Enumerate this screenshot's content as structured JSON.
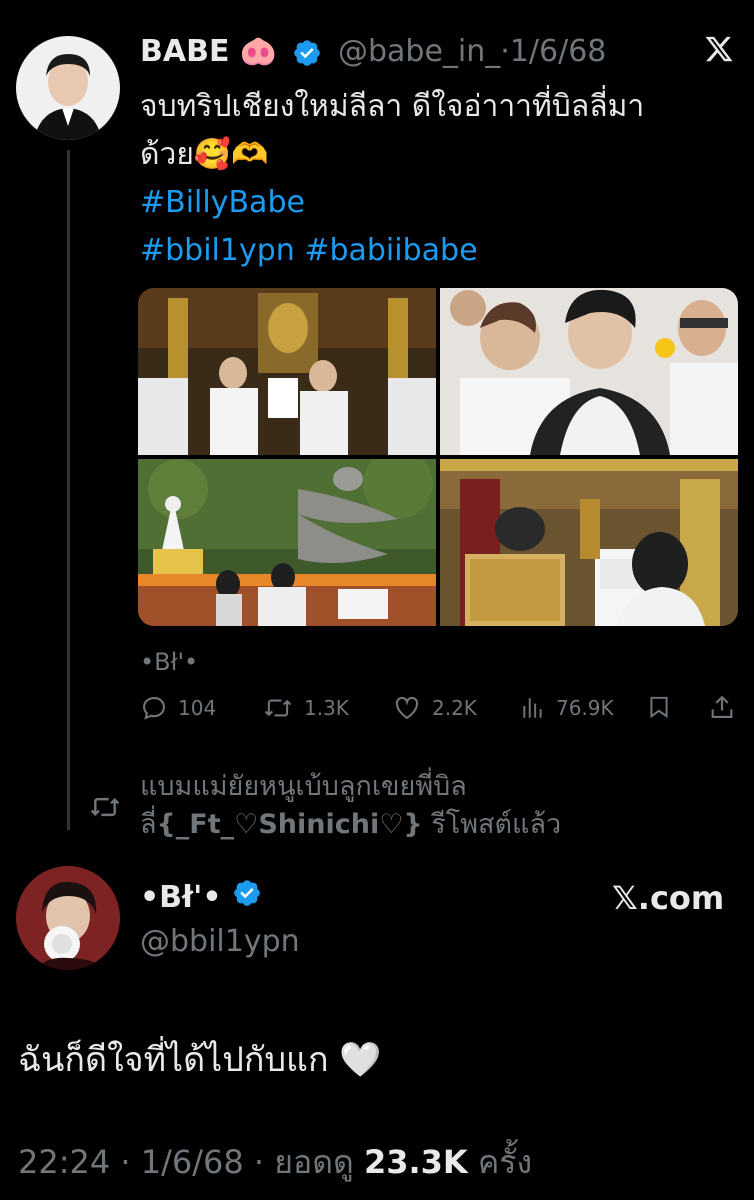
{
  "quoted_tweet": {
    "author_name": "BABE 🐽",
    "handle": "@babe_in_",
    "date": "1/6/68",
    "text_line1": "จบทริปเชียงใหม่ลีลา ดีใจอ่าาาที่บิลลี่มา",
    "text_line2": "ด้วย🥰🫶",
    "hashtag1": "#BillyBabe",
    "hashtag2": "#bbil1ypn #babiibabe",
    "author_small": "•Bł'•",
    "actions": {
      "replies": "104",
      "reposts": "1.3K",
      "likes": "2.2K",
      "views": "76.9K"
    }
  },
  "repost_notice": {
    "text_prefix": "แบมแม่ยัยหนูเบ้บลูกเขยพี่บิล ลี่",
    "reposter": "{_Ft_♡Shinichi♡}",
    "text_suffix": " รีโพสต์แล้ว"
  },
  "main_tweet": {
    "author_name": "•Bł'•",
    "handle": "@bbil1ypn",
    "site": "𝕏.com",
    "text": "ฉันก็ดีใจที่ได้ไปกับแก 🤍",
    "time": "22:24",
    "date": "1/6/68",
    "views_label": "ยอดดู",
    "views": "23.3K",
    "views_suffix": "ครั้ง"
  },
  "colors": {
    "background": "#000000",
    "text": "#e7e9ea",
    "muted": "#71767b",
    "link": "#1d9bf0",
    "verified": "#1d9bf0"
  },
  "icons": [
    "verified-badge-icon",
    "x-logo-icon",
    "reply-icon",
    "repost-icon",
    "like-icon",
    "views-icon",
    "bookmark-icon",
    "share-icon"
  ]
}
